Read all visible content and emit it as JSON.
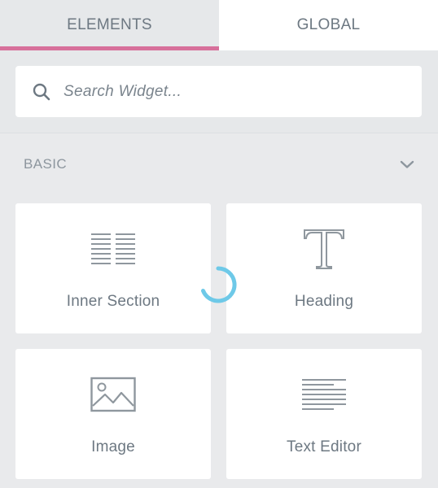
{
  "tabs": [
    {
      "label": "ELEMENTS",
      "active": true
    },
    {
      "label": "GLOBAL",
      "active": false
    }
  ],
  "search": {
    "placeholder": "Search Widget...",
    "value": "",
    "icon": "search-icon"
  },
  "category": {
    "title": "BASIC",
    "expanded": true,
    "icon": "chevron-down-icon"
  },
  "widgets": [
    {
      "label": "Inner Section",
      "icon": "columns-icon"
    },
    {
      "label": "Heading",
      "icon": "heading-t-icon"
    },
    {
      "label": "Image",
      "icon": "image-icon"
    },
    {
      "label": "Text Editor",
      "icon": "text-editor-icon"
    }
  ],
  "loading": {
    "icon": "loading-spinner-icon",
    "visible": true
  },
  "colors": {
    "accent_tab_border": "#d7709b",
    "spinner": "#6ec9e8",
    "panel_bg": "#e6e8ea",
    "text": "#6d7882",
    "icon_gray": "#8f979e"
  }
}
